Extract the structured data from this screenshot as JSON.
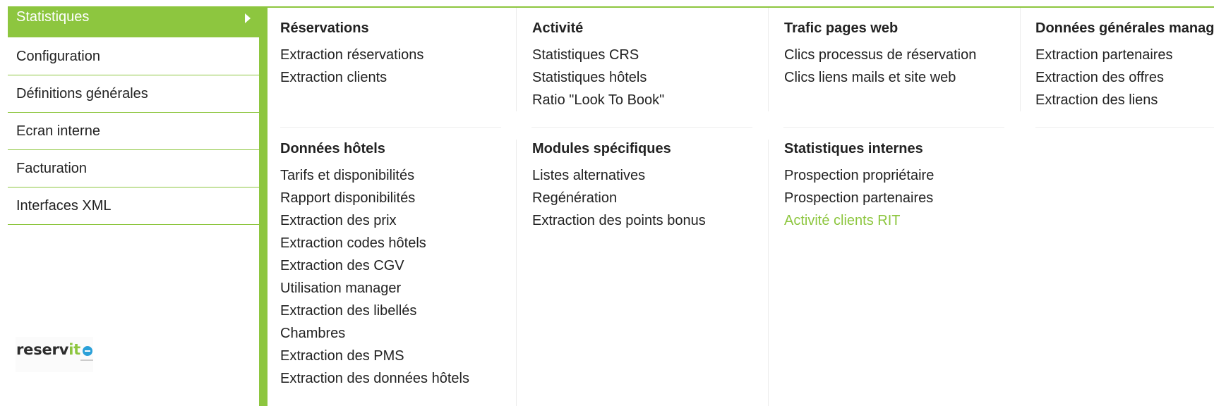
{
  "sidebar": {
    "items": [
      {
        "label": "Statistiques",
        "active": true
      },
      {
        "label": "Configuration"
      },
      {
        "label": "Définitions générales"
      },
      {
        "label": "Ecran interne"
      },
      {
        "label": "Facturation"
      },
      {
        "label": "Interfaces XML"
      }
    ],
    "logo": {
      "text_main": "reserv",
      "text_accent": "it"
    }
  },
  "menu": {
    "reservations": {
      "title": "Réservations",
      "links": [
        "Extraction réservations",
        "Extraction clients"
      ]
    },
    "activite": {
      "title": "Activité",
      "links": [
        "Statistiques CRS",
        "Statistiques hôtels",
        "Ratio \"Look To Book\""
      ]
    },
    "trafic": {
      "title": "Trafic pages web",
      "links": [
        "Clics processus de réservation",
        "Clics liens mails et site web"
      ]
    },
    "donnees_manager": {
      "title": "Données générales manager",
      "links": [
        "Extraction partenaires",
        "Extraction des offres",
        "Extraction des liens"
      ]
    },
    "donnees_hotels": {
      "title": "Données hôtels",
      "links": [
        "Tarifs et disponibilités",
        "Rapport disponibilités",
        "Extraction des prix",
        "Extraction codes hôtels",
        "Extraction des CGV",
        "Utilisation manager",
        "Extraction des libellés",
        "Chambres",
        "Extraction des PMS",
        "Extraction des données hôtels"
      ]
    },
    "modules": {
      "title": "Modules spécifiques",
      "links": [
        "Listes alternatives",
        "Regénération",
        "Extraction des points bonus"
      ]
    },
    "stats_internes": {
      "title": "Statistiques internes",
      "links": [
        "Prospection propriétaire",
        "Prospection partenaires",
        "Activité clients RIT"
      ]
    }
  },
  "colors": {
    "accent": "#8dc63f",
    "text": "#222222"
  }
}
